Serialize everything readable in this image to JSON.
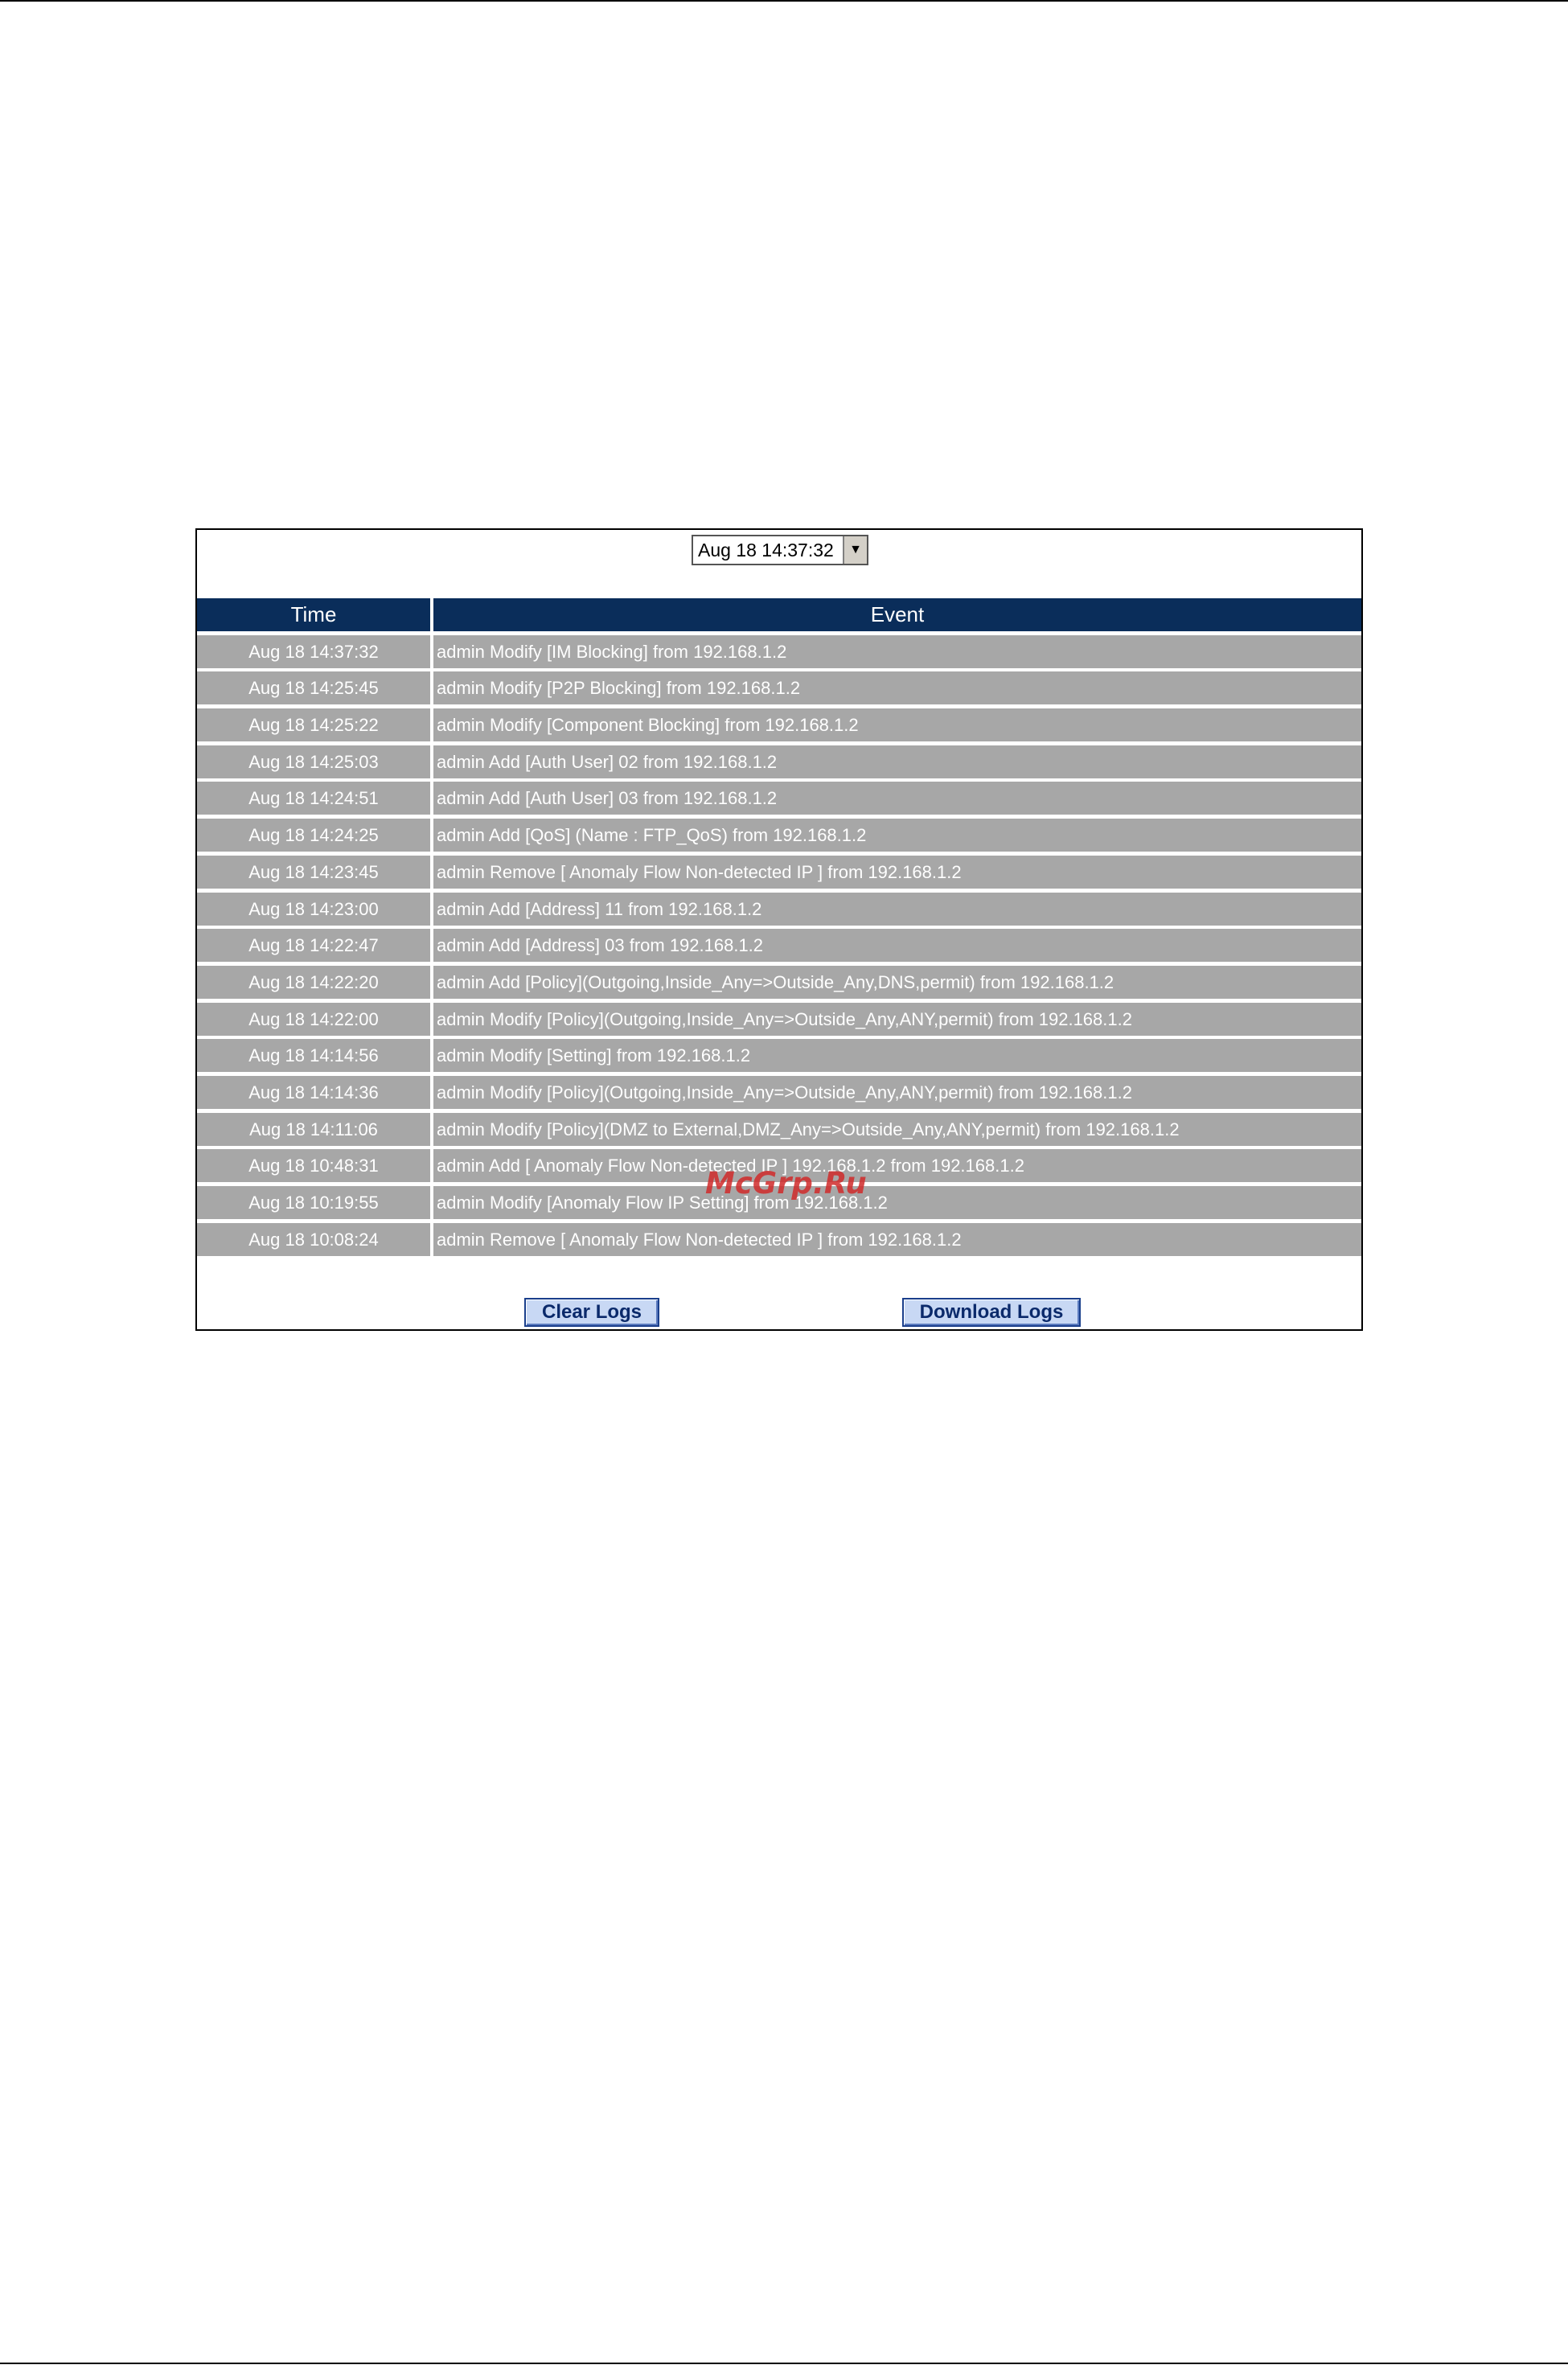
{
  "filter": {
    "selected": "Aug 18 14:37:32"
  },
  "table": {
    "columns": [
      "Time",
      "Event"
    ],
    "rows": [
      {
        "time": "Aug 18 14:37:32",
        "event": "admin Modify [IM Blocking] from 192.168.1.2"
      },
      {
        "time": "Aug 18 14:25:45",
        "event": "admin Modify [P2P Blocking] from 192.168.1.2"
      },
      {
        "time": "Aug 18 14:25:22",
        "event": "admin Modify [Component Blocking] from 192.168.1.2"
      },
      {
        "time": "Aug 18 14:25:03",
        "event": "admin Add [Auth User] 02 from 192.168.1.2"
      },
      {
        "time": "Aug 18 14:24:51",
        "event": "admin Add [Auth User] 03 from 192.168.1.2"
      },
      {
        "time": "Aug 18 14:24:25",
        "event": "admin Add [QoS] (Name : FTP_QoS) from 192.168.1.2"
      },
      {
        "time": "Aug 18 14:23:45",
        "event": "admin Remove [ Anomaly Flow Non-detected IP ] from 192.168.1.2"
      },
      {
        "time": "Aug 18 14:23:00",
        "event": "admin Add [Address] 11 from 192.168.1.2"
      },
      {
        "time": "Aug 18 14:22:47",
        "event": "admin Add [Address] 03 from 192.168.1.2"
      },
      {
        "time": "Aug 18 14:22:20",
        "event": "admin Add [Policy](Outgoing,Inside_Any=>Outside_Any,DNS,permit) from 192.168.1.2"
      },
      {
        "time": "Aug 18 14:22:00",
        "event": "admin Modify [Policy](Outgoing,Inside_Any=>Outside_Any,ANY,permit) from 192.168.1.2"
      },
      {
        "time": "Aug 18 14:14:56",
        "event": "admin Modify [Setting] from 192.168.1.2"
      },
      {
        "time": "Aug 18 14:14:36",
        "event": "admin Modify [Policy](Outgoing,Inside_Any=>Outside_Any,ANY,permit) from 192.168.1.2"
      },
      {
        "time": "Aug 18 14:11:06",
        "event": "admin Modify [Policy](DMZ to External,DMZ_Any=>Outside_Any,ANY,permit) from 192.168.1.2"
      },
      {
        "time": "Aug 18 10:48:31",
        "event": "admin Add [ Anomaly Flow Non-detected IP ] 192.168.1.2 from 192.168.1.2"
      },
      {
        "time": "Aug 18 10:19:55",
        "event": "admin Modify [Anomaly Flow IP Setting] from 192.168.1.2"
      },
      {
        "time": "Aug 18 10:08:24",
        "event": "admin Remove [ Anomaly Flow Non-detected IP ] from 192.168.1.2"
      }
    ]
  },
  "buttons": {
    "clear": "Clear Logs",
    "download": "Download Logs"
  },
  "watermark": "McGrp.Ru",
  "icons": {
    "dropdown": "chevron-down-icon"
  },
  "colors": {
    "header_bg": "#0a2d5a",
    "row_bg": "#a7a7a7",
    "button_bg": "#c8d8f4",
    "watermark": "#d12b2b"
  }
}
